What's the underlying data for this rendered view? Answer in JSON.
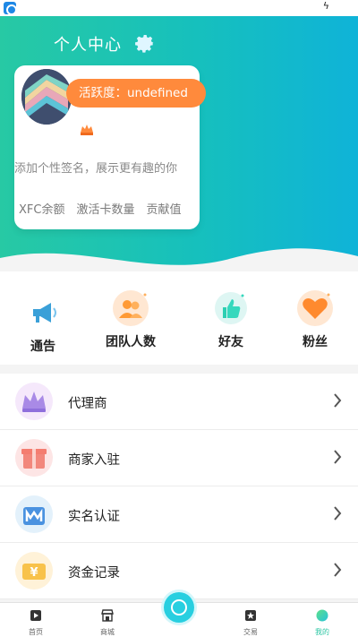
{
  "header": {
    "title": "个人中心"
  },
  "profile": {
    "activity_label": "活跃度：undefined",
    "signature": "添加个性签名，展示更有趣的你",
    "stats": [
      "XFC余额",
      "激活卡数量",
      "贡献值"
    ]
  },
  "quick_actions": [
    {
      "label": "通告",
      "icon": "megaphone-icon"
    },
    {
      "label": "团队人数",
      "icon": "team-icon"
    },
    {
      "label": "好友",
      "icon": "thumbs-up-icon"
    },
    {
      "label": "粉丝",
      "icon": "heart-icon"
    }
  ],
  "menu": [
    {
      "label": "代理商",
      "icon": "crown-icon"
    },
    {
      "label": "商家入驻",
      "icon": "gift-box-icon"
    },
    {
      "label": "实名认证",
      "icon": "id-card-icon"
    },
    {
      "label": "资金记录",
      "icon": "yuan-coin-icon"
    }
  ],
  "tabbar": {
    "home": "首页",
    "mall": "商城",
    "trade": "交易",
    "mine": "我的"
  },
  "colors": {
    "gradient_start": "#27c9a4",
    "gradient_end": "#0fb3d8",
    "badge": "#ff8a3c",
    "accent": "#2bc6a3"
  }
}
